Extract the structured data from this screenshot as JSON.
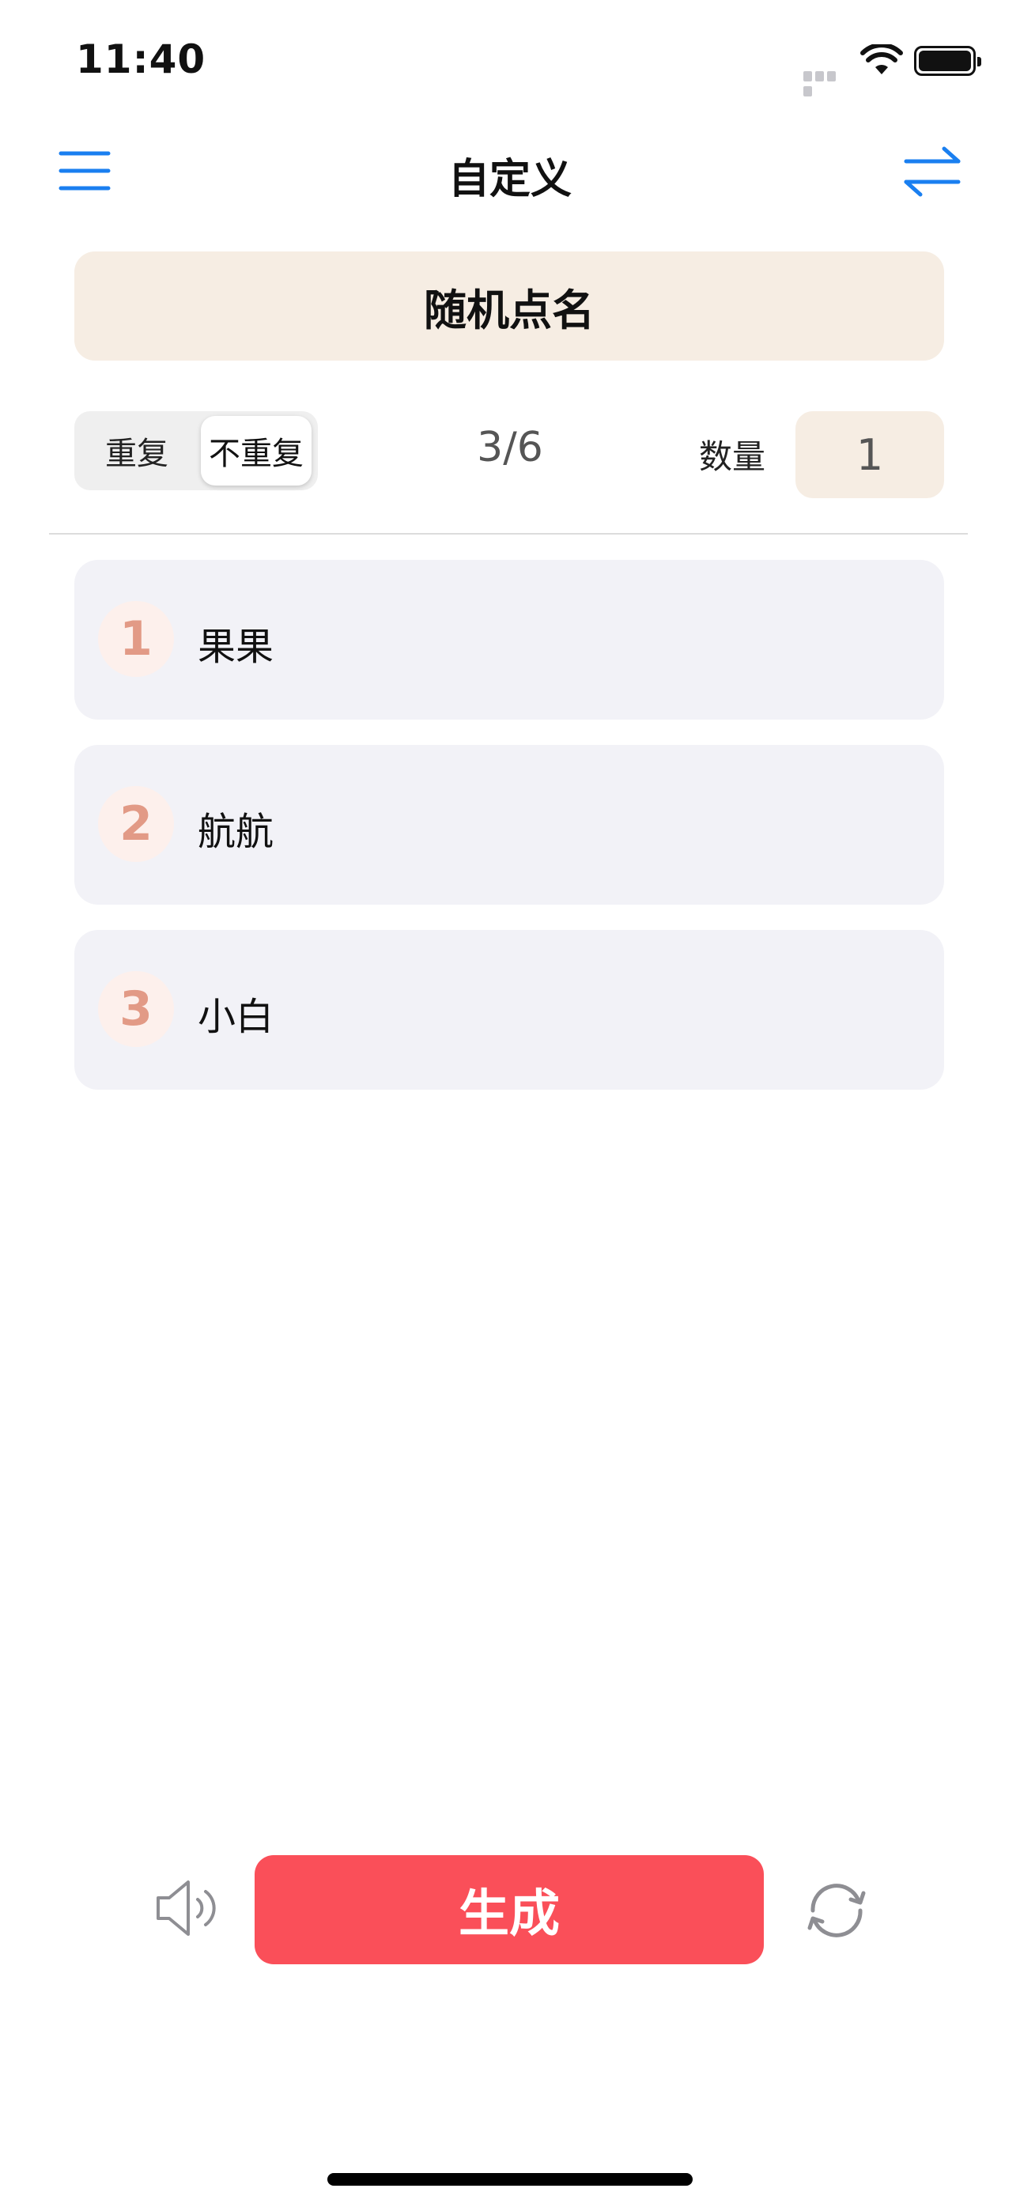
{
  "status_bar": {
    "time": "11:40"
  },
  "nav": {
    "title": "自定义",
    "menu_icon": "menu-icon",
    "swap_icon": "swap-icon"
  },
  "banner": {
    "title": "随机点名"
  },
  "controls": {
    "mode_options": [
      "重复",
      "不重复"
    ],
    "selected_mode": "不重复",
    "counter": "3/6",
    "quantity_label": "数量",
    "quantity_value": "1"
  },
  "results": [
    {
      "index": "1",
      "name": "果果"
    },
    {
      "index": "2",
      "name": "航航"
    },
    {
      "index": "3",
      "name": "小白"
    }
  ],
  "toolbar": {
    "generate_label": "生成",
    "sound_icon": "speaker-icon",
    "reset_icon": "refresh-icon"
  },
  "colors": {
    "accent_blue": "#1a7ff0",
    "generate_red": "#fa4f59",
    "banner_bg": "#f6ede3",
    "row_bg": "#f2f2f7",
    "badge_text": "#e29a86",
    "badge_bg": "#fdf0ec"
  }
}
